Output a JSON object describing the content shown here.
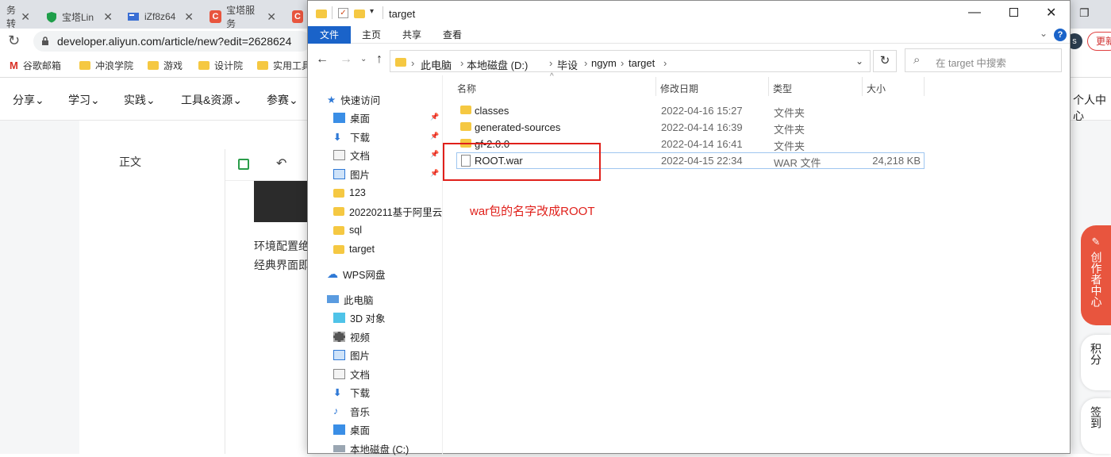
{
  "browser": {
    "tabs": [
      {
        "label": "务转",
        "icon": "generic"
      },
      {
        "label": "宝塔Lin",
        "icon": "shield"
      },
      {
        "label": "iZf8z64",
        "icon": "terminal"
      },
      {
        "label": "宝塔服务",
        "icon": "c-logo"
      },
      {
        "label": "",
        "icon": "c-logo"
      }
    ],
    "url": "developer.aliyun.com/article/new?edit=2628624",
    "bookmarks": [
      "谷歌邮箱",
      "冲浪学院",
      "游戏",
      "设计院",
      "实用工具"
    ],
    "right_button": "更新",
    "profile_initial": "s"
  },
  "site": {
    "nav": [
      "分享",
      "学习",
      "实践",
      "工具&资源",
      "参赛"
    ],
    "user_center": "个人中心",
    "side_label": "正文",
    "editor_text": [
      "环境配置绝",
      "经典界面即"
    ],
    "float_buttons": [
      {
        "label": "创作者中心",
        "color": "#e8553e"
      },
      {
        "label": "积分"
      },
      {
        "label": "签到"
      }
    ]
  },
  "explorer": {
    "title": "target",
    "ribbon_tabs": [
      "文件",
      "主页",
      "共享",
      "查看"
    ],
    "breadcrumb": [
      "此电脑",
      "本地磁盘 (D:)",
      "毕设",
      "ngym",
      "target"
    ],
    "search_placeholder": "在 target 中搜索",
    "columns": [
      "名称",
      "修改日期",
      "类型",
      "大小"
    ],
    "files": [
      {
        "name": "classes",
        "date": "2022-04-16 15:27",
        "type": "文件夹",
        "size": "",
        "kind": "folder"
      },
      {
        "name": "generated-sources",
        "date": "2022-04-14 16:39",
        "type": "文件夹",
        "size": "",
        "kind": "folder"
      },
      {
        "name": "gf-2.0.0",
        "date": "2022-04-14 16:41",
        "type": "文件夹",
        "size": "",
        "kind": "folder"
      },
      {
        "name": "ROOT.war",
        "date": "2022-04-15 22:34",
        "type": "WAR 文件",
        "size": "24,218 KB",
        "kind": "file"
      }
    ],
    "annotation": "war包的名字改成ROOT",
    "annotation_color": "#e0201b",
    "sidebar": {
      "quick_access": "快速访问",
      "quick_items": [
        {
          "label": "桌面",
          "icon": "desktop"
        },
        {
          "label": "下载",
          "icon": "download"
        },
        {
          "label": "文档",
          "icon": "document"
        },
        {
          "label": "图片",
          "icon": "picture"
        },
        {
          "label": "123",
          "icon": "folder"
        },
        {
          "label": "20220211基于阿里云",
          "icon": "folder"
        },
        {
          "label": "sql",
          "icon": "folder"
        },
        {
          "label": "target",
          "icon": "folder"
        }
      ],
      "wps": "WPS网盘",
      "this_pc": "此电脑",
      "pc_items": [
        {
          "label": "3D 对象",
          "icon": "cube"
        },
        {
          "label": "视频",
          "icon": "video"
        },
        {
          "label": "图片",
          "icon": "picture"
        },
        {
          "label": "文档",
          "icon": "document"
        },
        {
          "label": "下载",
          "icon": "download"
        },
        {
          "label": "音乐",
          "icon": "music"
        },
        {
          "label": "桌面",
          "icon": "desktop"
        },
        {
          "label": "本地磁盘 (C:)",
          "icon": "disk"
        }
      ]
    }
  }
}
